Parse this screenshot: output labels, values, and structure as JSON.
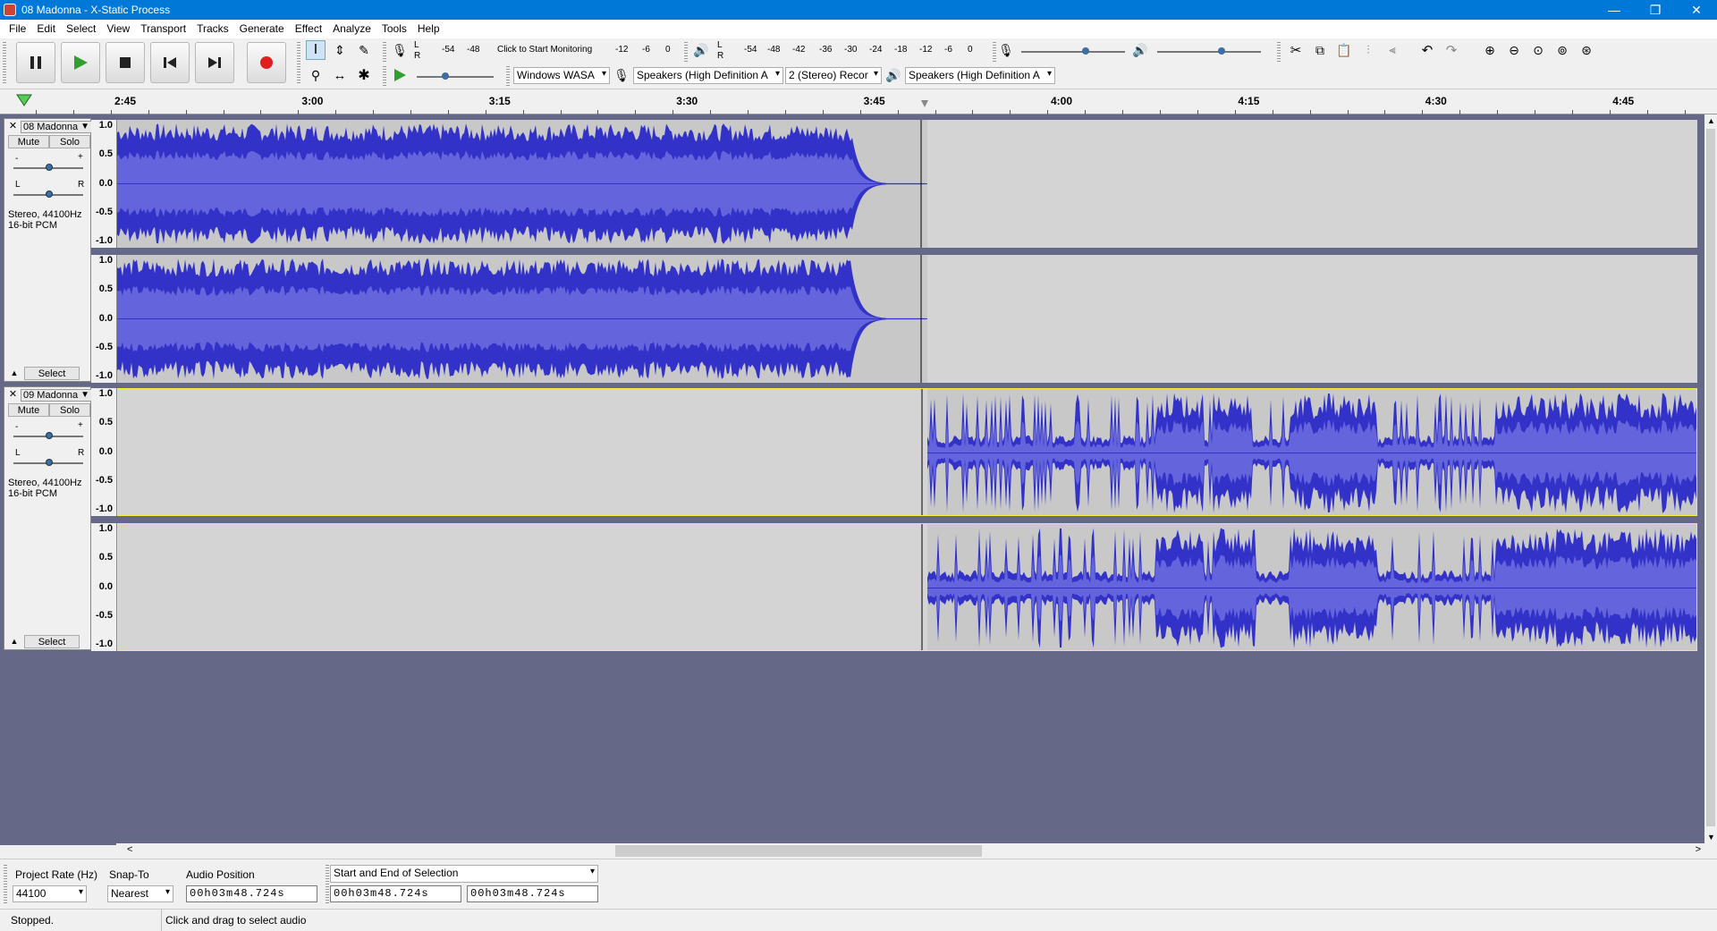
{
  "window": {
    "title": "08 Madonna - X-Static Process",
    "min": "—",
    "max": "❐",
    "close": "✕"
  },
  "menu": [
    "File",
    "Edit",
    "Select",
    "View",
    "Transport",
    "Tracks",
    "Generate",
    "Effect",
    "Analyze",
    "Tools",
    "Help"
  ],
  "meters": {
    "record_ticks": [
      "-54",
      "-48",
      "Click to Start Monitoring",
      "-12",
      "-6",
      "0"
    ],
    "play_ticks": [
      "-54",
      "-48",
      "-42",
      "-36",
      "-30",
      "-24",
      "-18",
      "-12",
      "-6",
      "0"
    ],
    "lr": [
      "L",
      "R"
    ]
  },
  "device": {
    "host": "Windows WASA",
    "rec_device": "Speakers (High Definition A",
    "channels": "2 (Stereo) Recor",
    "play_device": "Speakers (High Definition A"
  },
  "ruler": {
    "labels": [
      "2:45",
      "3:00",
      "3:15",
      "3:30",
      "3:45",
      "4:00",
      "4:15",
      "4:30",
      "4:45"
    ]
  },
  "tracks": [
    {
      "name": "08 Madonna",
      "mute": "Mute",
      "solo": "Solo",
      "info1": "Stereo, 44100Hz",
      "info2": "16-bit PCM",
      "select": "Select",
      "scale": [
        "1.0",
        "0.5",
        "0.0",
        "-0.5",
        "-1.0"
      ]
    },
    {
      "name": "09 Madonna",
      "mute": "Mute",
      "solo": "Solo",
      "info1": "Stereo, 44100Hz",
      "info2": "16-bit PCM",
      "select": "Select",
      "scale": [
        "1.0",
        "0.5",
        "0.0",
        "-0.5",
        "-1.0"
      ]
    }
  ],
  "selection_toolbar": {
    "rate_label": "Project Rate (Hz)",
    "rate_value": "44100",
    "snap_label": "Snap-To",
    "snap_value": "Nearest",
    "pos_label": "Audio Position",
    "pos_value": "00h03m48.724s",
    "sel_mode": "Start and End of Selection",
    "sel_start": "00h03m48.724s",
    "sel_end": "00h03m48.724s"
  },
  "status": {
    "state": "Stopped.",
    "hint": "Click and drag to select audio"
  },
  "colors": {
    "wave": "#3232c8",
    "wave_rms": "#6464dc",
    "title_bar": "#0078d7",
    "background": "#666888"
  }
}
